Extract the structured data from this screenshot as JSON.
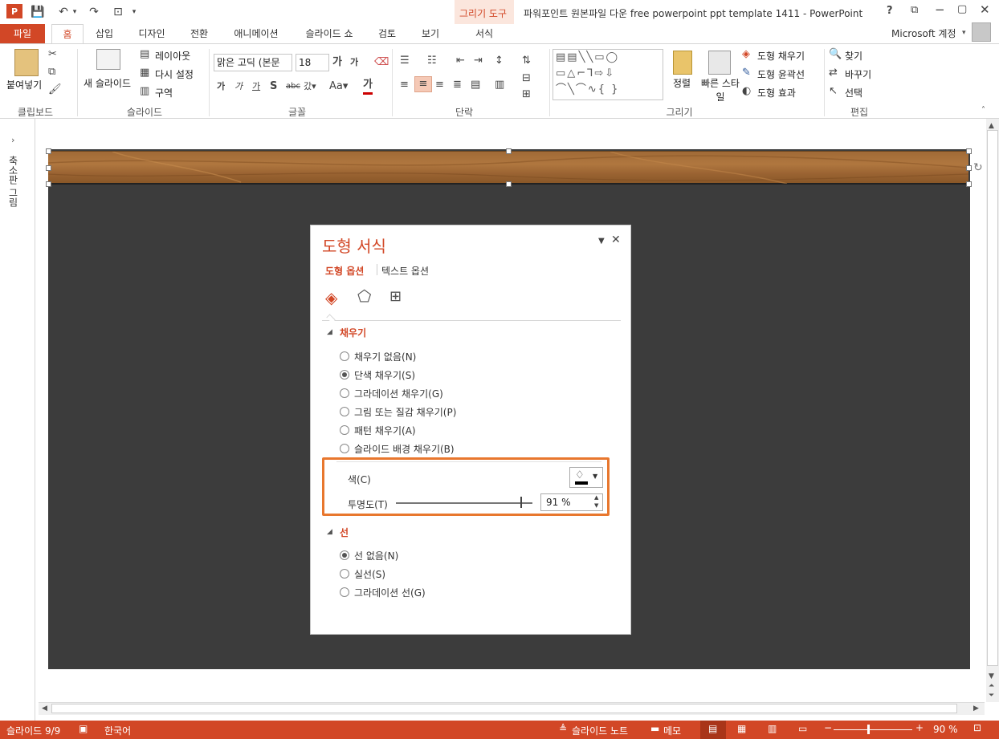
{
  "window": {
    "title": "파워포인트 원본파일 다운 free powerpoint ppt template 1411 - PowerPoint",
    "help": "?",
    "account": "Microsoft 계정"
  },
  "contextual": {
    "group": "그리기 도구",
    "tab": "서식"
  },
  "tabs": [
    {
      "label": "파일"
    },
    {
      "label": "홈"
    },
    {
      "label": "삽입"
    },
    {
      "label": "디자인"
    },
    {
      "label": "전환"
    },
    {
      "label": "애니메이션"
    },
    {
      "label": "슬라이드 쇼"
    },
    {
      "label": "검토"
    },
    {
      "label": "보기"
    }
  ],
  "ribbon": {
    "clipboard": {
      "paste": "붙여넣기",
      "group": "클립보드"
    },
    "slides": {
      "new_slide": "새 슬라이드",
      "layout": "레이아웃",
      "reset": "다시 설정",
      "section": "구역",
      "group": "슬라이드"
    },
    "font": {
      "name": "맑은 고딕 (본문",
      "size": "18",
      "group": "글꼴"
    },
    "paragraph": {
      "group": "단락"
    },
    "drawing": {
      "arrange": "정렬",
      "quick_styles": "빠른 스타일",
      "fill": "도형 채우기",
      "outline": "도형 윤곽선",
      "effects": "도형 효과",
      "group": "그리기"
    },
    "editing": {
      "find": "찾기",
      "replace": "바꾸기",
      "select": "선택",
      "group": "편집"
    }
  },
  "left_pane": {
    "label": "축소판 그림"
  },
  "panel": {
    "title": "도형 서식",
    "tab_shape": "도형 옵션",
    "tab_text": "텍스트 옵션",
    "fill_section": "채우기",
    "fill_options": [
      {
        "label": "채우기 없음(N)",
        "selected": false
      },
      {
        "label": "단색 채우기(S)",
        "selected": true
      },
      {
        "label": "그라데이션 채우기(G)",
        "selected": false
      },
      {
        "label": "그림 또는 질감 채우기(P)",
        "selected": false
      },
      {
        "label": "패턴 채우기(A)",
        "selected": false
      },
      {
        "label": "슬라이드 배경 채우기(B)",
        "selected": false
      }
    ],
    "color_label": "색(C)",
    "transparency_label": "투명도(T)",
    "transparency_value": "91 %",
    "transparency_fraction": 0.91,
    "line_section": "선",
    "line_options": [
      {
        "label": "선 없음(N)",
        "selected": true
      },
      {
        "label": "실선(S)",
        "selected": false
      },
      {
        "label": "그라데이션 선(G)",
        "selected": false
      }
    ],
    "accent_color": "#d24726",
    "highlight_color": "#e8772e"
  },
  "status": {
    "slide": "슬라이드 9/9",
    "language": "한국어",
    "notes": "슬라이드 노트",
    "comments": "메모",
    "zoom": "90 %"
  }
}
